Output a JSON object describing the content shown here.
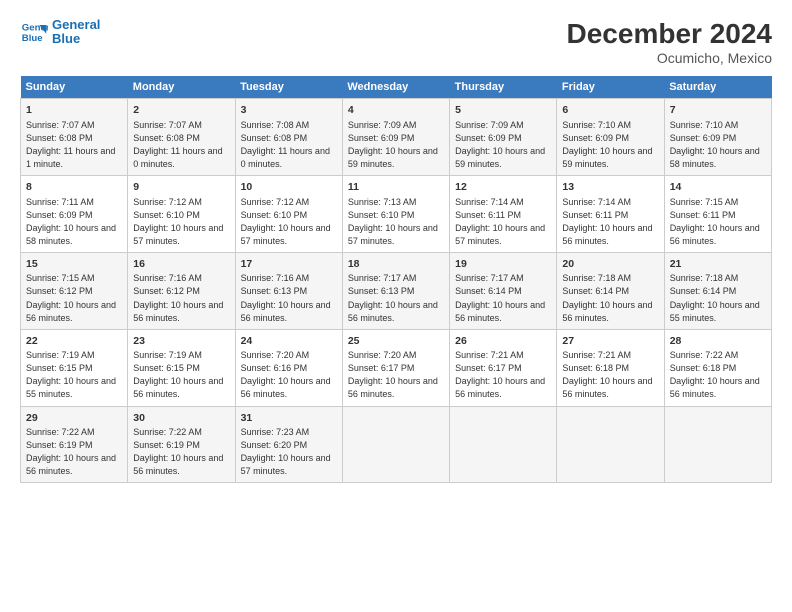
{
  "logo": {
    "line1": "General",
    "line2": "Blue"
  },
  "title": "December 2024",
  "subtitle": "Ocumicho, Mexico",
  "headers": [
    "Sunday",
    "Monday",
    "Tuesday",
    "Wednesday",
    "Thursday",
    "Friday",
    "Saturday"
  ],
  "weeks": [
    [
      {
        "day": "1",
        "sunrise": "7:07 AM",
        "sunset": "6:08 PM",
        "daylight": "11 hours and 1 minute."
      },
      {
        "day": "2",
        "sunrise": "7:07 AM",
        "sunset": "6:08 PM",
        "daylight": "11 hours and 0 minutes."
      },
      {
        "day": "3",
        "sunrise": "7:08 AM",
        "sunset": "6:08 PM",
        "daylight": "11 hours and 0 minutes."
      },
      {
        "day": "4",
        "sunrise": "7:09 AM",
        "sunset": "6:09 PM",
        "daylight": "10 hours and 59 minutes."
      },
      {
        "day": "5",
        "sunrise": "7:09 AM",
        "sunset": "6:09 PM",
        "daylight": "10 hours and 59 minutes."
      },
      {
        "day": "6",
        "sunrise": "7:10 AM",
        "sunset": "6:09 PM",
        "daylight": "10 hours and 59 minutes."
      },
      {
        "day": "7",
        "sunrise": "7:10 AM",
        "sunset": "6:09 PM",
        "daylight": "10 hours and 58 minutes."
      }
    ],
    [
      {
        "day": "8",
        "sunrise": "7:11 AM",
        "sunset": "6:09 PM",
        "daylight": "10 hours and 58 minutes."
      },
      {
        "day": "9",
        "sunrise": "7:12 AM",
        "sunset": "6:10 PM",
        "daylight": "10 hours and 57 minutes."
      },
      {
        "day": "10",
        "sunrise": "7:12 AM",
        "sunset": "6:10 PM",
        "daylight": "10 hours and 57 minutes."
      },
      {
        "day": "11",
        "sunrise": "7:13 AM",
        "sunset": "6:10 PM",
        "daylight": "10 hours and 57 minutes."
      },
      {
        "day": "12",
        "sunrise": "7:14 AM",
        "sunset": "6:11 PM",
        "daylight": "10 hours and 57 minutes."
      },
      {
        "day": "13",
        "sunrise": "7:14 AM",
        "sunset": "6:11 PM",
        "daylight": "10 hours and 56 minutes."
      },
      {
        "day": "14",
        "sunrise": "7:15 AM",
        "sunset": "6:11 PM",
        "daylight": "10 hours and 56 minutes."
      }
    ],
    [
      {
        "day": "15",
        "sunrise": "7:15 AM",
        "sunset": "6:12 PM",
        "daylight": "10 hours and 56 minutes."
      },
      {
        "day": "16",
        "sunrise": "7:16 AM",
        "sunset": "6:12 PM",
        "daylight": "10 hours and 56 minutes."
      },
      {
        "day": "17",
        "sunrise": "7:16 AM",
        "sunset": "6:13 PM",
        "daylight": "10 hours and 56 minutes."
      },
      {
        "day": "18",
        "sunrise": "7:17 AM",
        "sunset": "6:13 PM",
        "daylight": "10 hours and 56 minutes."
      },
      {
        "day": "19",
        "sunrise": "7:17 AM",
        "sunset": "6:14 PM",
        "daylight": "10 hours and 56 minutes."
      },
      {
        "day": "20",
        "sunrise": "7:18 AM",
        "sunset": "6:14 PM",
        "daylight": "10 hours and 56 minutes."
      },
      {
        "day": "21",
        "sunrise": "7:18 AM",
        "sunset": "6:14 PM",
        "daylight": "10 hours and 55 minutes."
      }
    ],
    [
      {
        "day": "22",
        "sunrise": "7:19 AM",
        "sunset": "6:15 PM",
        "daylight": "10 hours and 55 minutes."
      },
      {
        "day": "23",
        "sunrise": "7:19 AM",
        "sunset": "6:15 PM",
        "daylight": "10 hours and 56 minutes."
      },
      {
        "day": "24",
        "sunrise": "7:20 AM",
        "sunset": "6:16 PM",
        "daylight": "10 hours and 56 minutes."
      },
      {
        "day": "25",
        "sunrise": "7:20 AM",
        "sunset": "6:17 PM",
        "daylight": "10 hours and 56 minutes."
      },
      {
        "day": "26",
        "sunrise": "7:21 AM",
        "sunset": "6:17 PM",
        "daylight": "10 hours and 56 minutes."
      },
      {
        "day": "27",
        "sunrise": "7:21 AM",
        "sunset": "6:18 PM",
        "daylight": "10 hours and 56 minutes."
      },
      {
        "day": "28",
        "sunrise": "7:22 AM",
        "sunset": "6:18 PM",
        "daylight": "10 hours and 56 minutes."
      }
    ],
    [
      {
        "day": "29",
        "sunrise": "7:22 AM",
        "sunset": "6:19 PM",
        "daylight": "10 hours and 56 minutes."
      },
      {
        "day": "30",
        "sunrise": "7:22 AM",
        "sunset": "6:19 PM",
        "daylight": "10 hours and 56 minutes."
      },
      {
        "day": "31",
        "sunrise": "7:23 AM",
        "sunset": "6:20 PM",
        "daylight": "10 hours and 57 minutes."
      },
      null,
      null,
      null,
      null
    ]
  ]
}
